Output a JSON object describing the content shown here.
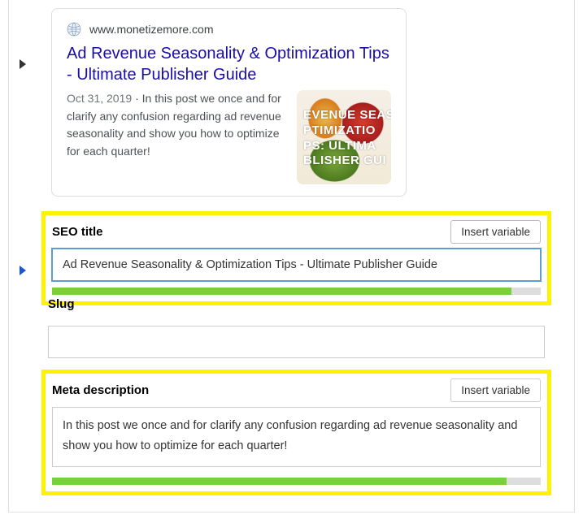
{
  "preview": {
    "domain": "www.monetizemore.com",
    "title": "Ad Revenue Seasonality & Optimization Tips - Ultimate Publisher Guide",
    "date": "Oct 31, 2019",
    "description": "In this post we once and for clarify any confusion regarding ad revenue seasonality and show you how to optimize for each quarter!",
    "thumb_overlay": "EVENUE SEASONALI\nPTIMIZATIO\nPS: ULTIMA\nBLISHER GUI"
  },
  "fields": {
    "seo_title": {
      "label": "SEO title",
      "insert_label": "Insert variable",
      "value": "Ad Revenue Seasonality & Optimization Tips - Ultimate Publisher Guide",
      "progress_percent": 94
    },
    "slug": {
      "label": "Slug",
      "value": ""
    },
    "meta_description": {
      "label": "Meta description",
      "insert_label": "Insert variable",
      "value": "In this post we once and for clarify any confusion regarding ad revenue seasonality and show you how to optimize for each quarter!",
      "progress_percent": 93
    }
  }
}
